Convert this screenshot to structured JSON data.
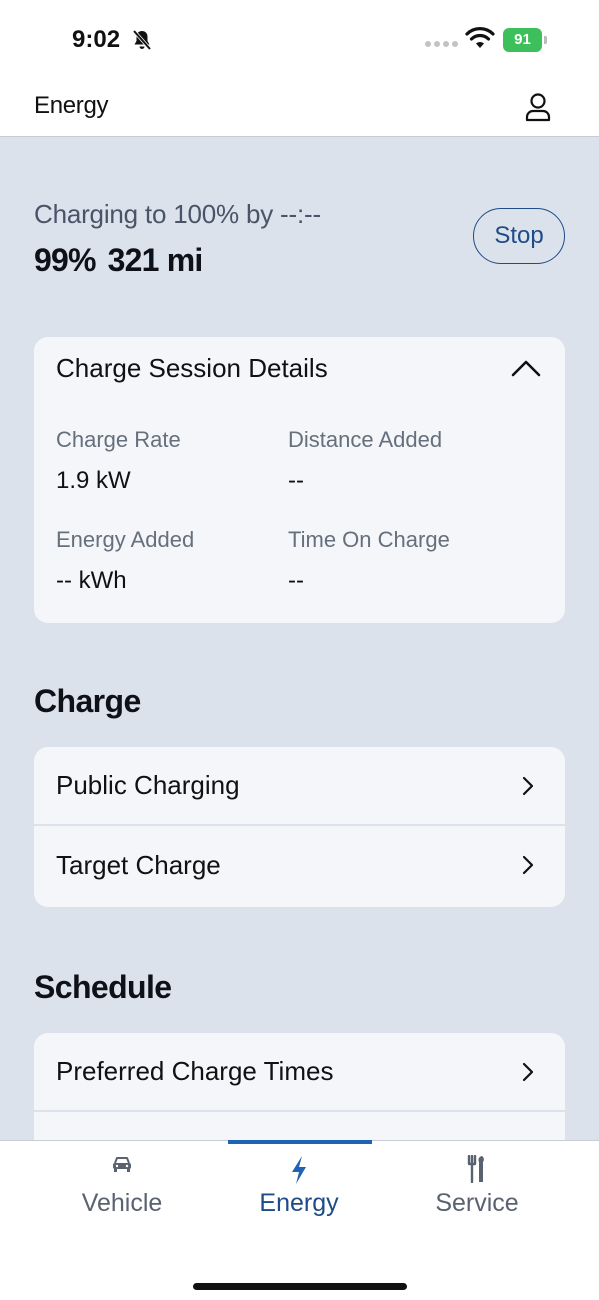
{
  "status_bar": {
    "time": "9:02",
    "battery": "91",
    "icons": [
      "bell-slash-icon",
      "signal-dots-icon",
      "wifi-icon",
      "battery-charging-icon"
    ]
  },
  "header": {
    "title": "Energy",
    "profile_icon": "person-icon"
  },
  "charge_status": {
    "line1": "Charging to 100% by --:--",
    "percent": "99%",
    "range": "321 mi",
    "stop_label": "Stop"
  },
  "session_card": {
    "title": "Charge Session Details",
    "stats": [
      {
        "label": "Charge Rate",
        "value": "1.9 kW"
      },
      {
        "label": "Distance Added",
        "value": "--"
      },
      {
        "label": "Energy Added",
        "value": "-- kWh"
      },
      {
        "label": "Time On Charge",
        "value": "--"
      }
    ]
  },
  "charge_section": {
    "title": "Charge",
    "items": [
      {
        "label": "Public Charging"
      },
      {
        "label": "Target Charge"
      }
    ]
  },
  "schedule_section": {
    "title": "Schedule",
    "items": [
      {
        "label": "Preferred Charge Times"
      },
      {
        "label": ""
      }
    ]
  },
  "tabs": [
    {
      "label": "Vehicle",
      "icon": "car-icon",
      "active": false
    },
    {
      "label": "Energy",
      "icon": "lightning-bolt-icon",
      "active": true
    },
    {
      "label": "Service",
      "icon": "tools-icon",
      "active": false
    }
  ],
  "colors": {
    "accent": "#1f4b86",
    "background": "#dbe2ec",
    "card": "#f4f6fa",
    "battery": "#3dbf5c"
  }
}
